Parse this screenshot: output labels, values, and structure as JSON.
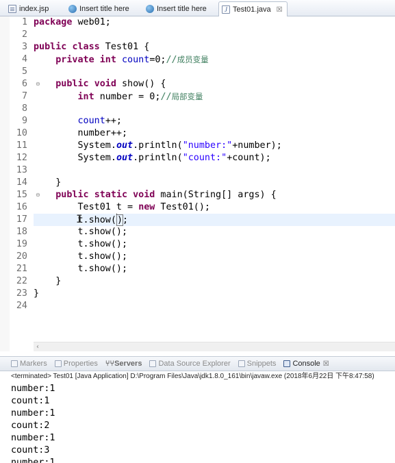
{
  "editor_tabs": [
    {
      "label": "index.jsp",
      "icon": "jsp-file-icon",
      "active": false
    },
    {
      "label": "Insert title here",
      "icon": "globe-icon",
      "active": false
    },
    {
      "label": "Insert title here",
      "icon": "globe-icon",
      "active": false
    },
    {
      "label": "Test01.java",
      "icon": "java-file-icon",
      "active": true,
      "close": "☒"
    }
  ],
  "editor": {
    "line_numbers": [
      "1",
      "2",
      "3",
      "4",
      "5",
      "6",
      "7",
      "8",
      "9",
      "10",
      "11",
      "12",
      "13",
      "14",
      "15",
      "16",
      "17",
      "18",
      "19",
      "20",
      "21",
      "22",
      "23",
      "24"
    ],
    "code": {
      "l1_kw": "package",
      "l1_rest": " web01;",
      "l3_kw1": "public",
      "l3_kw2": "class",
      "l3_rest": " Test01 {",
      "l4_kw1": "private",
      "l4_kw2": "int",
      "l4_field": "count",
      "l4_rest": "=0;",
      "l4_comment": "//",
      "l4_comment_cn": "成员变量",
      "l6_kw1": "public",
      "l6_kw2": "void",
      "l6_rest": " show() {",
      "l7_kw": "int",
      "l7_rest": " number = 0;",
      "l7_comment": "//",
      "l7_comment_cn": "局部变量",
      "l9_field": "count",
      "l9_rest": "++;",
      "l10_text": "number++;",
      "l11_pre": "System.",
      "l11_out": "out",
      "l11_mid": ".println(",
      "l11_str": "\"number:\"",
      "l11_post": "+number);",
      "l12_pre": "System.",
      "l12_out": "out",
      "l12_mid": ".println(",
      "l12_str": "\"count:\"",
      "l12_post": "+count);",
      "l14_text": "}",
      "l15_kw1": "public",
      "l15_kw2": "static",
      "l15_kw3": "void",
      "l15_rest": " main(String[] args) {",
      "l16_pre": "Test01 t = ",
      "l16_kw": "new",
      "l16_post": " Test01();",
      "l17_pre": "t.show(",
      "l17_bracket": ")",
      "l17_post": ";",
      "l18_text": "t.show();",
      "l19_text": "t.show();",
      "l20_text": "t.show();",
      "l21_text": "t.show();",
      "l22_text": "}",
      "l23_text": "}"
    },
    "scroll_left": "‹"
  },
  "views": {
    "tabs": [
      {
        "label": "Markers",
        "icon": "markers-icon"
      },
      {
        "label": "Properties",
        "icon": "properties-icon"
      },
      {
        "label": "Servers",
        "icon": "servers-icon",
        "prefix": "⑂⑂ "
      },
      {
        "label": "Data Source Explorer",
        "icon": "data-source-icon"
      },
      {
        "label": "Snippets",
        "icon": "snippets-icon"
      },
      {
        "label": "Console",
        "icon": "console-icon",
        "active": true,
        "close": "☒"
      }
    ],
    "console_status": "<terminated> Test01 [Java Application] D:\\Program Files\\Java\\jdk1.8.0_161\\bin\\javaw.exe (2018年6月22日 下午8:47:58)",
    "console_lines": [
      "number:1",
      "count:1",
      "number:1",
      "count:2",
      "number:1",
      "count:3",
      "number:1"
    ]
  },
  "colors": {
    "keyword": "#7f0055",
    "field": "#0000c0",
    "string": "#2a00ff",
    "comment": "#3f7f5f",
    "current_line": "#e8f2fe",
    "marker_bar": "#a8c7ef"
  }
}
